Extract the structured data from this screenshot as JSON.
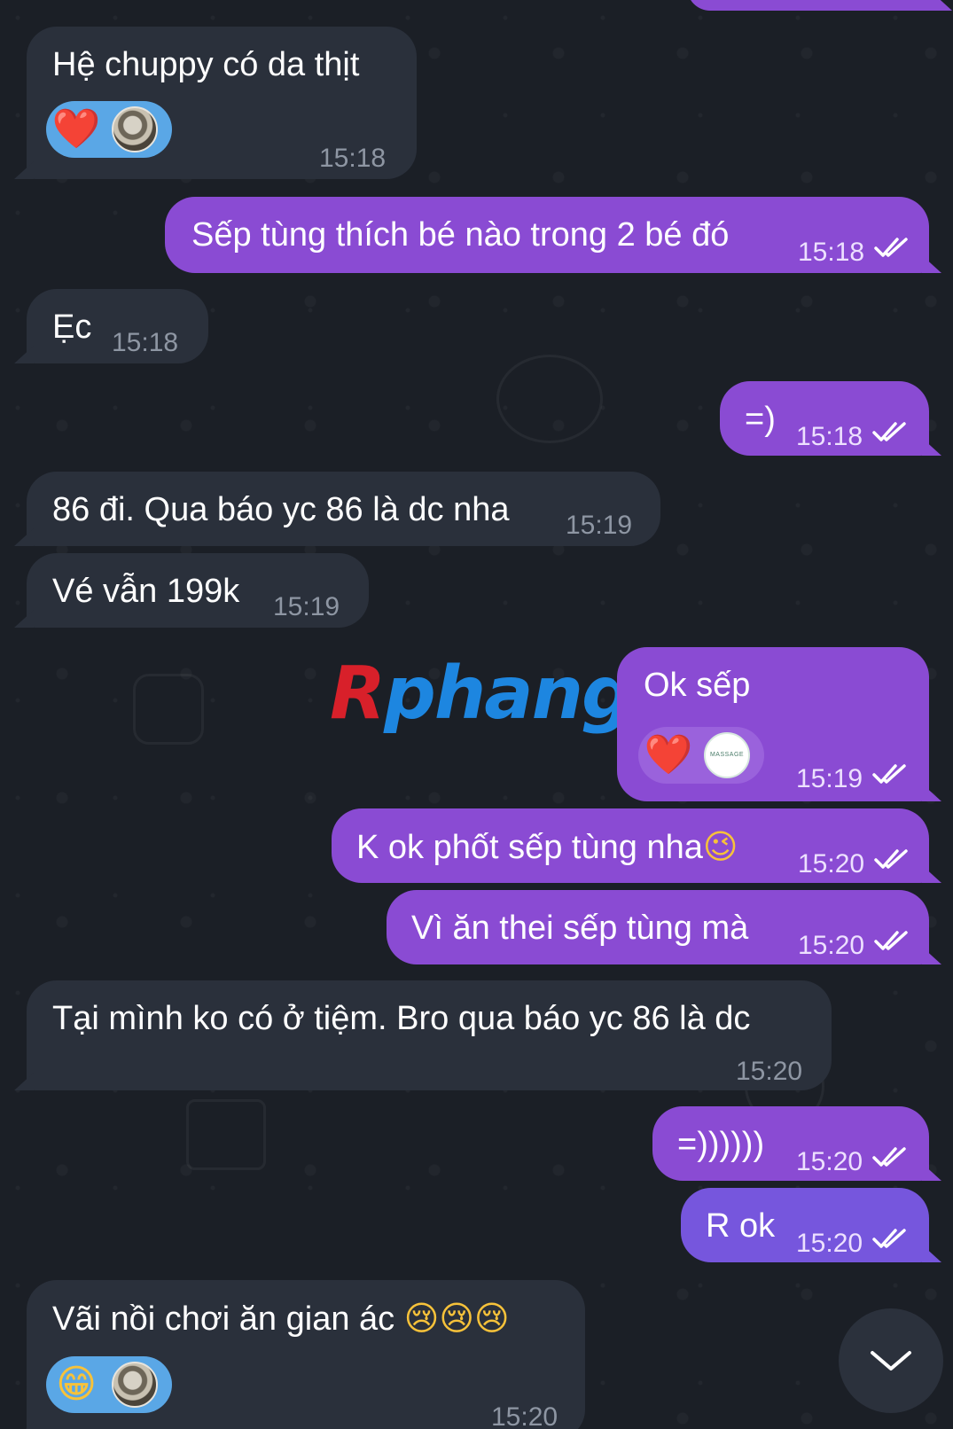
{
  "messages": [
    {
      "id": "m1",
      "direction": "incoming",
      "text": "Hệ chuppy có da thịt",
      "time": "15:18",
      "reaction_emoji": "❤️"
    },
    {
      "id": "m2",
      "direction": "outgoing",
      "text": "Sếp tùng thích bé nào trong 2 bé đó",
      "time": "15:18",
      "read": true
    },
    {
      "id": "m3",
      "direction": "incoming",
      "text": "Ẹc",
      "time": "15:18"
    },
    {
      "id": "m4",
      "direction": "outgoing",
      "text": "=)",
      "time": "15:18",
      "read": true
    },
    {
      "id": "m5",
      "direction": "incoming",
      "text": "86 đi. Qua báo yc 86 là dc nha",
      "time": "15:19"
    },
    {
      "id": "m6",
      "direction": "incoming",
      "text": "Vé vẫn 199k",
      "time": "15:19"
    },
    {
      "id": "m7",
      "direction": "outgoing",
      "text": "Ok sếp",
      "time": "15:19",
      "read": true,
      "reaction_emoji": "❤️",
      "reaction_avatar_text": "MASSAGE"
    },
    {
      "id": "m8",
      "direction": "outgoing",
      "text": "K ok phốt sếp tùng nha",
      "emoji": "😉",
      "time": "15:20",
      "read": true
    },
    {
      "id": "m9",
      "direction": "outgoing",
      "text": "Vì ăn thei sếp tùng mà",
      "time": "15:20",
      "read": true
    },
    {
      "id": "m10",
      "direction": "incoming",
      "text": "Tại mình ko có ở tiệm. Bro qua báo yc 86 là dc",
      "time": "15:20"
    },
    {
      "id": "m11",
      "direction": "outgoing",
      "text": "=))))))",
      "time": "15:20",
      "read": true
    },
    {
      "id": "m12",
      "direction": "outgoing",
      "text": "R ok",
      "time": "15:20",
      "read": true
    },
    {
      "id": "m13",
      "direction": "incoming",
      "text": "Vãi nồi chơi ăn gian ác",
      "emoji": "😢😢😢",
      "time": "15:20",
      "reaction_emoji": "😁"
    }
  ],
  "watermark": {
    "part1": "R",
    "part2": "phang"
  },
  "scroll_down_icon": "chevron-down-icon",
  "colors": {
    "background": "#1b1f26",
    "incoming_bubble": "#2a303b",
    "outgoing_bubble": "#8a4bd3",
    "outgoing_bubble_alt": "#7656dd",
    "reaction_incoming": "#5aa7e6"
  }
}
